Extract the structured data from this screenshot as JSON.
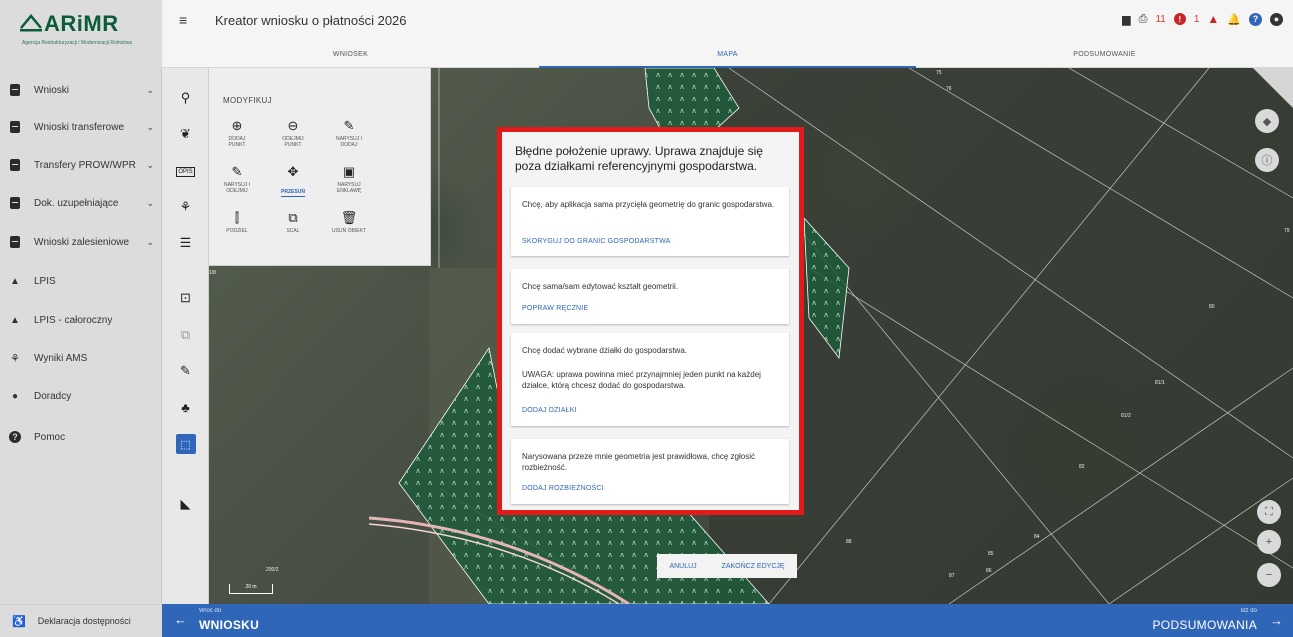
{
  "logo": {
    "name": "ARiMR",
    "subtitle": "Agencja Restrukturyzacji i Modernizacji Rolnictwa"
  },
  "header": {
    "title": "Kreator wniosku o płatności 2026",
    "counts": {
      "errors": "11",
      "warnings": "1"
    },
    "tabs": [
      "WNIOSEK",
      "MAPA",
      "PODSUMOWANIE"
    ]
  },
  "sidebar": {
    "items": [
      {
        "label": "Wnioski",
        "icon": "document-icon",
        "chevron": true
      },
      {
        "label": "Wnioski transferowe",
        "icon": "document-icon",
        "chevron": true
      },
      {
        "label": "Transfery PROW/WPR",
        "icon": "document-icon",
        "chevron": true
      },
      {
        "label": "Dok. uzupełniające",
        "icon": "document-icon",
        "chevron": true
      },
      {
        "label": "Wnioski zalesieniowe",
        "icon": "document-icon",
        "chevron": true
      },
      {
        "label": "LPIS",
        "icon": "terrain-icon",
        "chevron": false
      },
      {
        "label": "LPIS - całoroczny",
        "icon": "terrain-icon",
        "chevron": false
      },
      {
        "label": "Wyniki AMS",
        "icon": "satellite-icon",
        "chevron": false
      },
      {
        "label": "Doradcy",
        "icon": "person-icon",
        "chevron": false
      },
      {
        "label": "Pomoc",
        "icon": "help-icon",
        "chevron": false
      }
    ],
    "footer": "Deklaracja dostępności"
  },
  "modify_panel": {
    "title": "MODYFIKUJ",
    "tools": [
      {
        "label": "DODAJ\nPUNKT",
        "glyph": "⊕"
      },
      {
        "label": "ODEJMIJ\nPUNKT",
        "glyph": "⊖"
      },
      {
        "label": "NARYSUJ I\nDODAJ",
        "glyph": "✎"
      },
      {
        "label": "NARYSUJ I\nODEJMIJ",
        "glyph": "✎"
      },
      {
        "label": "PRZESUŃ",
        "glyph": "✥"
      },
      {
        "label": "NARYSUJ\nENKLAWĘ",
        "glyph": "▣"
      },
      {
        "label": "PODZIEL",
        "glyph": "⫿"
      },
      {
        "label": "SCAL",
        "glyph": "⧉"
      },
      {
        "label": "USUŃ OBIEKT",
        "glyph": "🗑"
      }
    ]
  },
  "dialog": {
    "title": "Błędne położenie uprawy. Uprawa znajduje się poza działkami referencyjnymi gospodarstwa.",
    "options": [
      {
        "text": "Chcę, aby aplikacja sama przycięła geometrię do granic gospodarstwa.",
        "action": "SKORYGUJ DO GRANIC GOSPODARSTWA"
      },
      {
        "text": "Chcę sama/sam edytować kształt geometrii.",
        "action": "POPRAW RĘCZNIE"
      },
      {
        "text": "Chcę dodać wybrane działki do gospodarstwa.",
        "note": "UWAGA: uprawa powinna mieć przynajmniej jeden punkt na każdej działce, którą chcesz dodać do gospodarstwa.",
        "action": "DODAJ DZIAŁKI"
      },
      {
        "text": "Narysowana przeze mnie geometria jest prawidłowa, chcę zgłosić rozbieżność.",
        "action": "DODAJ ROZBIEŻNOŚCI"
      }
    ]
  },
  "map": {
    "edit_cancel": "ANULUJ",
    "edit_finish": "ZAKOŃCZ EDYCJĘ",
    "scale": "20 m",
    "parcel_labels": [
      "75",
      "76",
      "79",
      "80",
      "81/1",
      "81/2",
      "82",
      "83",
      "84",
      "85",
      "86",
      "87",
      "88",
      "200/2",
      "1/8"
    ]
  },
  "footer": {
    "back_sub": "Wróć do",
    "back_main": "WNIOSKU",
    "next_sub": "Idź do",
    "next_main": "PODSUMOWANIA"
  }
}
